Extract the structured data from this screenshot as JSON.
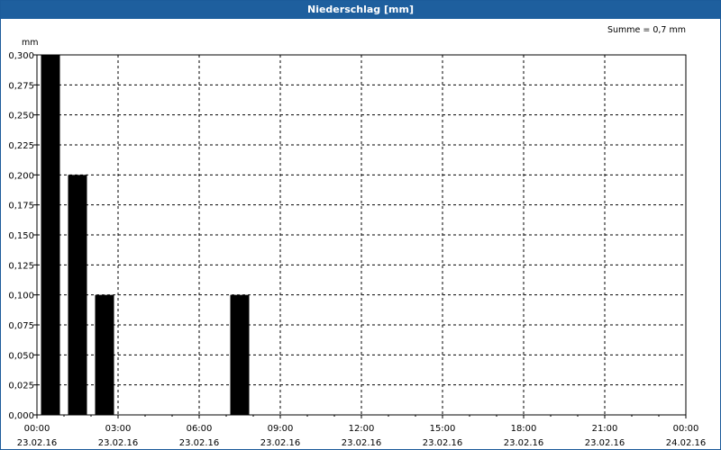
{
  "window": {
    "title": "Niederschlag [mm]"
  },
  "chart_data": {
    "type": "bar",
    "title": "Niederschlag [mm]",
    "ylabel": "mm",
    "summary": "Summe = 0,7 mm",
    "ylim": [
      0,
      0.3
    ],
    "y_ticks": [
      "0,000",
      "0,025",
      "0,050",
      "0,075",
      "0,100",
      "0,125",
      "0,150",
      "0,175",
      "0,200",
      "0,225",
      "0,250",
      "0,275",
      "0,300"
    ],
    "x_ticks": [
      {
        "time": "00:00",
        "date": "23.02.16"
      },
      {
        "time": "03:00",
        "date": "23.02.16"
      },
      {
        "time": "06:00",
        "date": "23.02.16"
      },
      {
        "time": "09:00",
        "date": "23.02.16"
      },
      {
        "time": "12:00",
        "date": "23.02.16"
      },
      {
        "time": "15:00",
        "date": "23.02.16"
      },
      {
        "time": "18:00",
        "date": "23.02.16"
      },
      {
        "time": "21:00",
        "date": "23.02.16"
      },
      {
        "time": "00:00",
        "date": "24.02.16"
      }
    ],
    "xlim": [
      "23.02.16 00:00",
      "24.02.16 00:00"
    ],
    "bar_interval": "1 h",
    "bars": [
      {
        "start": "23.02.16 00:00",
        "value": 0.3
      },
      {
        "start": "23.02.16 01:00",
        "value": 0.2
      },
      {
        "start": "23.02.16 02:00",
        "value": 0.1
      },
      {
        "start": "23.02.16 07:00",
        "value": 0.1
      }
    ],
    "grid": true,
    "bar_color": "#000000"
  }
}
